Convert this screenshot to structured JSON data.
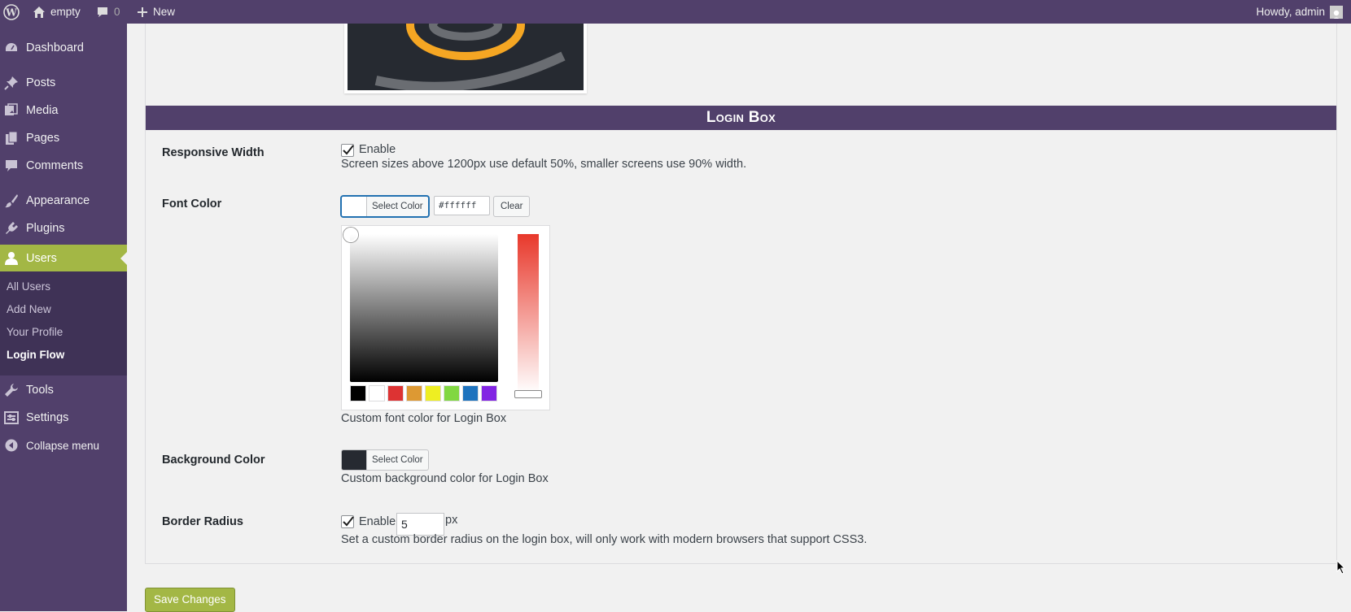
{
  "adminbar": {
    "site_name": "empty",
    "comments_count": "0",
    "new_label": "New",
    "howdy": "Howdy, admin"
  },
  "sidebar": {
    "items": [
      {
        "label": "Dashboard",
        "icon": "dashboard-icon"
      },
      {
        "label": "Posts",
        "icon": "pin-icon"
      },
      {
        "label": "Media",
        "icon": "media-icon"
      },
      {
        "label": "Pages",
        "icon": "pages-icon"
      },
      {
        "label": "Comments",
        "icon": "comment-icon"
      },
      {
        "label": "Appearance",
        "icon": "brush-icon"
      },
      {
        "label": "Plugins",
        "icon": "plugin-icon"
      },
      {
        "label": "Users",
        "icon": "user-icon"
      },
      {
        "label": "Tools",
        "icon": "wrench-icon"
      },
      {
        "label": "Settings",
        "icon": "settings-icon"
      },
      {
        "label": "Collapse menu",
        "icon": "collapse-icon"
      }
    ],
    "submenu": [
      "All Users",
      "Add New",
      "Your Profile",
      "Login Flow"
    ]
  },
  "main": {
    "section_title": "Login Box",
    "responsive": {
      "label": "Responsive Width",
      "checkbox_label": "Enable",
      "checked": true,
      "description": "Screen sizes above 1200px use default 50%, smaller screens use 90% width."
    },
    "font_color": {
      "label": "Font Color",
      "select_label": "Select Color",
      "hex_value": "#ffffff",
      "clear_label": "Clear",
      "swatch_color": "#ffffff",
      "palette": [
        "#000000",
        "#ffffff",
        "#dd3333",
        "#dd9933",
        "#eeee22",
        "#81d742",
        "#1e73be",
        "#8224e3"
      ],
      "description": "Custom font color for Login Box"
    },
    "background_color": {
      "label": "Background Color",
      "select_label": "Select Color",
      "swatch_color": "#262a31",
      "description": "Custom background color for Login Box"
    },
    "border_radius": {
      "label": "Border Radius",
      "checkbox_label": "Enable",
      "checked": true,
      "value": "5",
      "unit": "px",
      "description": "Set a custom border radius on the login box, will only work with modern browsers that support CSS3."
    },
    "save_label": "Save Changes"
  },
  "colors": {
    "admin_purple": "#51406b",
    "accent_green": "#a3b745"
  }
}
